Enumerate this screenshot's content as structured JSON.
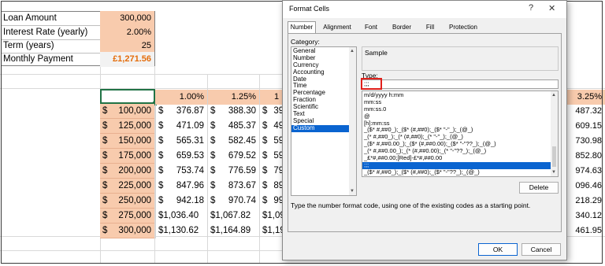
{
  "sheet": {
    "inputs": [
      {
        "label": "Loan Amount",
        "value": "300,000"
      },
      {
        "label": "Interest Rate (yearly)",
        "value": "2.00%"
      },
      {
        "label": "Term (years)",
        "value": "25"
      },
      {
        "label": "Monthly Payment",
        "value": "£1,271.56"
      }
    ],
    "rate_headers": [
      "1.00%",
      "1.25%",
      "1"
    ],
    "rate_header_right": "3.25%",
    "currency_symbol": "$",
    "rows": [
      {
        "amount": "100,000",
        "c1": "376.87",
        "c2": "388.30",
        "c3": "39",
        "right": "487.32"
      },
      {
        "amount": "125,000",
        "c1": "471.09",
        "c2": "485.37",
        "c3": "49",
        "right": "609.15"
      },
      {
        "amount": "150,000",
        "c1": "565.31",
        "c2": "582.45",
        "c3": "59",
        "right": "730.98"
      },
      {
        "amount": "175,000",
        "c1": "659.53",
        "c2": "679.52",
        "c3": "59",
        "right": "852.80"
      },
      {
        "amount": "200,000",
        "c1": "753.74",
        "c2": "776.59",
        "c3": "79",
        "right": "974.63"
      },
      {
        "amount": "225,000",
        "c1": "847.96",
        "c2": "873.67",
        "c3": "89",
        "right": "096.46"
      },
      {
        "amount": "250,000",
        "c1": "942.18",
        "c2": "970.74",
        "c3": "99",
        "right": "218.29"
      },
      {
        "amount": "275,000",
        "c1": "$1,036.40",
        "c2": "$1,067.82",
        "c3": "$1,09",
        "right": "340.12"
      },
      {
        "amount": "300,000",
        "c1": "$1,130.62",
        "c2": "$1,164.89",
        "c3": "$1,19",
        "right": "461.95"
      }
    ]
  },
  "dialog": {
    "title": "Format Cells",
    "help_glyph": "?",
    "close_glyph": "✕",
    "tabs": [
      "Number",
      "Alignment",
      "Font",
      "Border",
      "Fill",
      "Protection"
    ],
    "category_label": "Category:",
    "categories": [
      "General",
      "Number",
      "Currency",
      "Accounting",
      "Date",
      "Time",
      "Percentage",
      "Fraction",
      "Scientific",
      "Text",
      "Special",
      "Custom"
    ],
    "selected_category": "Custom",
    "sample_label": "Sample",
    "sample_value": "",
    "type_label": "Type:",
    "type_value": ";;;",
    "formats": [
      "m/d/yyyy h:mm",
      "mm:ss",
      "mm:ss.0",
      "@",
      "[h]:mm:ss",
      "_($* #,##0_);_($* (#,##0);_($* \"-\"_);_(@_)",
      "_(* #,##0_);_(* (#,##0);_(* \"-\"_);_(@_)",
      "_($* #,##0.00_);_($* (#,##0.00);_($* \"-\"??_);_(@_)",
      "_(* #,##0.00_);_(* (#,##0.00);_(* \"-\"??_);_(@_)",
      "_£*#,##0.00;[Red]-£*#,##0.00",
      ";;;",
      "_($* #,##0_);_($* (#,##0);_($* \"-\"??_);_(@_)"
    ],
    "selected_format": ";;;",
    "delete_label": "Delete",
    "hint": "Type the number format code, using one of the existing codes as a starting point.",
    "ok_label": "OK",
    "cancel_label": "Cancel",
    "colors": {
      "accent": "#0a64d0",
      "type_highlight": "#e0201b",
      "cell_fill": "#f8cbad",
      "payment_text": "#e46c0a"
    }
  }
}
